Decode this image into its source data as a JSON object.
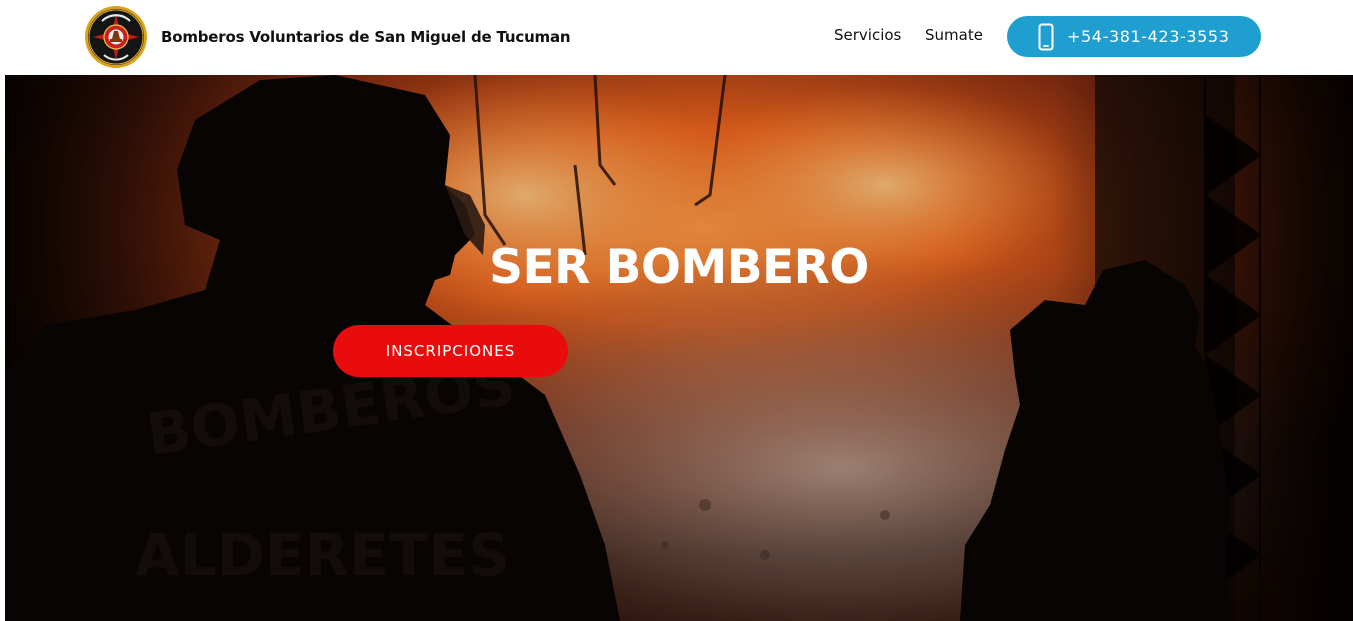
{
  "header": {
    "brand_name": "Bomberos Voluntarios de San Miguel de Tucuman",
    "logo_icon": "fire-department-emblem-icon",
    "nav": [
      {
        "label": "Servicios"
      },
      {
        "label": "Sumate"
      }
    ],
    "phone": {
      "icon": "mobile-phone-icon",
      "number": "+54-381-423-3553"
    }
  },
  "hero": {
    "title": "SER BOMBERO",
    "cta_label": "INSCRIPCIONES",
    "background": "firefighters-silhouettes-fire-photo",
    "background_text": "BOMBEROS ALDERETES"
  },
  "colors": {
    "phone_button": "#1f9fd0",
    "cta_button": "#e90c0c",
    "header_bg": "#ffffff",
    "text": "#111111"
  }
}
